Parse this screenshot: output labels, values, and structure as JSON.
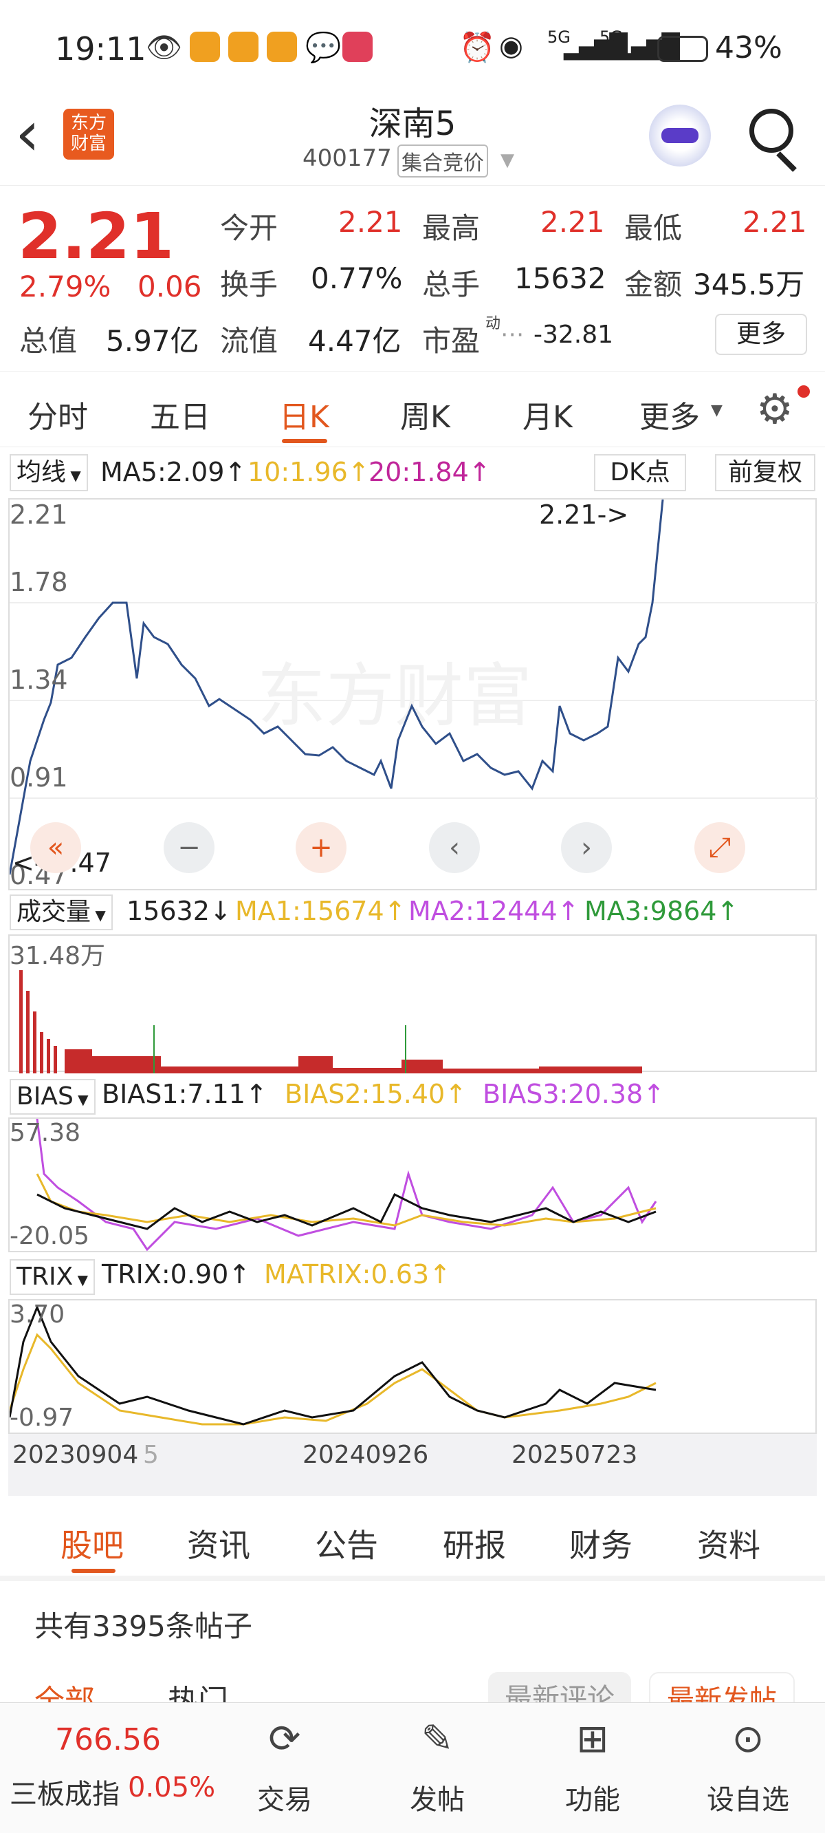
{
  "status": {
    "time": "19:11",
    "battery": "43%",
    "net1": "5G",
    "net2": "5G"
  },
  "header": {
    "back": "‹",
    "logo": "东方\n财富",
    "title": "深南5",
    "code": "400177",
    "auction": "集合竞价"
  },
  "quote": {
    "price": "2.21",
    "change_pct": "2.79%",
    "change": "0.06",
    "open_label": "今开",
    "open": "2.21",
    "high_label": "最高",
    "high": "2.21",
    "low_label": "最低",
    "low": "2.21",
    "turnover_label": "换手",
    "turnover": "0.77%",
    "volume_label": "总手",
    "volume": "15632",
    "amount_label": "金额",
    "amount": "345.5万",
    "mktcap_label": "总值",
    "mktcap": "5.97亿",
    "float_label": "流值",
    "float": "4.47亿",
    "pe_label": "市盈",
    "pe_sup": "动",
    "pe": "-32.81",
    "more": "更多"
  },
  "tabs": [
    "分时",
    "五日",
    "日K",
    "周K",
    "月K",
    "更多"
  ],
  "ma_bar": {
    "selector": "均线",
    "ma5": "MA5:2.09↑",
    "ma10": "10:1.96↑",
    "ma20": "20:1.84↑",
    "dk": "DK点",
    "adjust": "前复权"
  },
  "kline": {
    "y1": "2.21",
    "y2": "1.78",
    "y3": "1.34",
    "y4": "0.91",
    "y5": "0.47",
    "max_tag": "2.21->",
    "min_tag": "<--0.47",
    "watermark": "东方财富"
  },
  "volume_bar": {
    "selector": "成交量",
    "value": "15632↓",
    "ma1": "MA1:15674↑",
    "ma2": "MA2:12444↑",
    "ma3": "MA3:9864↑",
    "ymax": "31.48万"
  },
  "bias_bar": {
    "selector": "BIAS",
    "b1": "BIAS1:7.11↑",
    "b2": "BIAS2:15.40↑",
    "b3": "BIAS3:20.38↑",
    "ymax": "57.38",
    "ymin": "-20.05"
  },
  "trix_bar": {
    "selector": "TRIX",
    "trix": "TRIX:0.90↑",
    "matrix": "MATRIX:0.63↑",
    "ymax": "3.70",
    "ymin": "-0.97"
  },
  "dates": {
    "d1": "20230904",
    "d1b": "5",
    "d2": "20240926",
    "d3": "20250723"
  },
  "controls": [
    "«",
    "−",
    "+",
    "‹",
    "›",
    "⤢"
  ],
  "bottom_tabs": [
    "股吧",
    "资讯",
    "公告",
    "研报",
    "财务",
    "资料"
  ],
  "forum": {
    "count": "共有3395条帖子",
    "sub1": "全部",
    "sub2": "热门",
    "sort1": "最新评论",
    "sort2": "最新发帖"
  },
  "index": {
    "value": "766.56",
    "name": "三板成指",
    "pct": "0.05%"
  },
  "bottom_buttons": [
    "交易",
    "发帖",
    "功能",
    "设自选"
  ],
  "colors": {
    "red": "#e0302a",
    "orange_active": "#e2571e",
    "ma10": "#e8b82a",
    "ma20": "#c0269a",
    "line": "#2f4f8a"
  }
}
